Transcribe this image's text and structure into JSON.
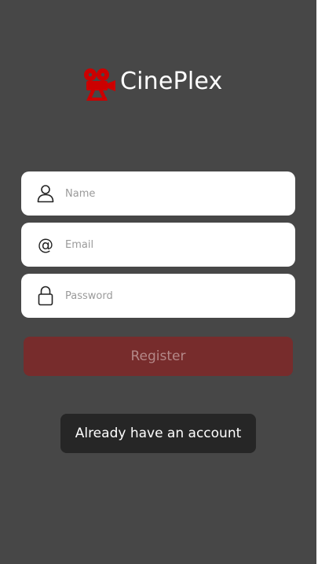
{
  "app": {
    "name": "CinePlex",
    "brand_color": "#cc0000",
    "background": "#474747"
  },
  "form": {
    "name_field": {
      "placeholder": "Name",
      "value": "",
      "icon": "user-icon"
    },
    "email_field": {
      "placeholder": "Email",
      "value": "",
      "icon": "at-icon"
    },
    "password_field": {
      "placeholder": "Password",
      "value": "",
      "icon": "lock-icon"
    },
    "at_symbol": "@"
  },
  "actions": {
    "register_label": "Register",
    "register_color": "#772c2c",
    "login_link_label": "Already have an account"
  }
}
